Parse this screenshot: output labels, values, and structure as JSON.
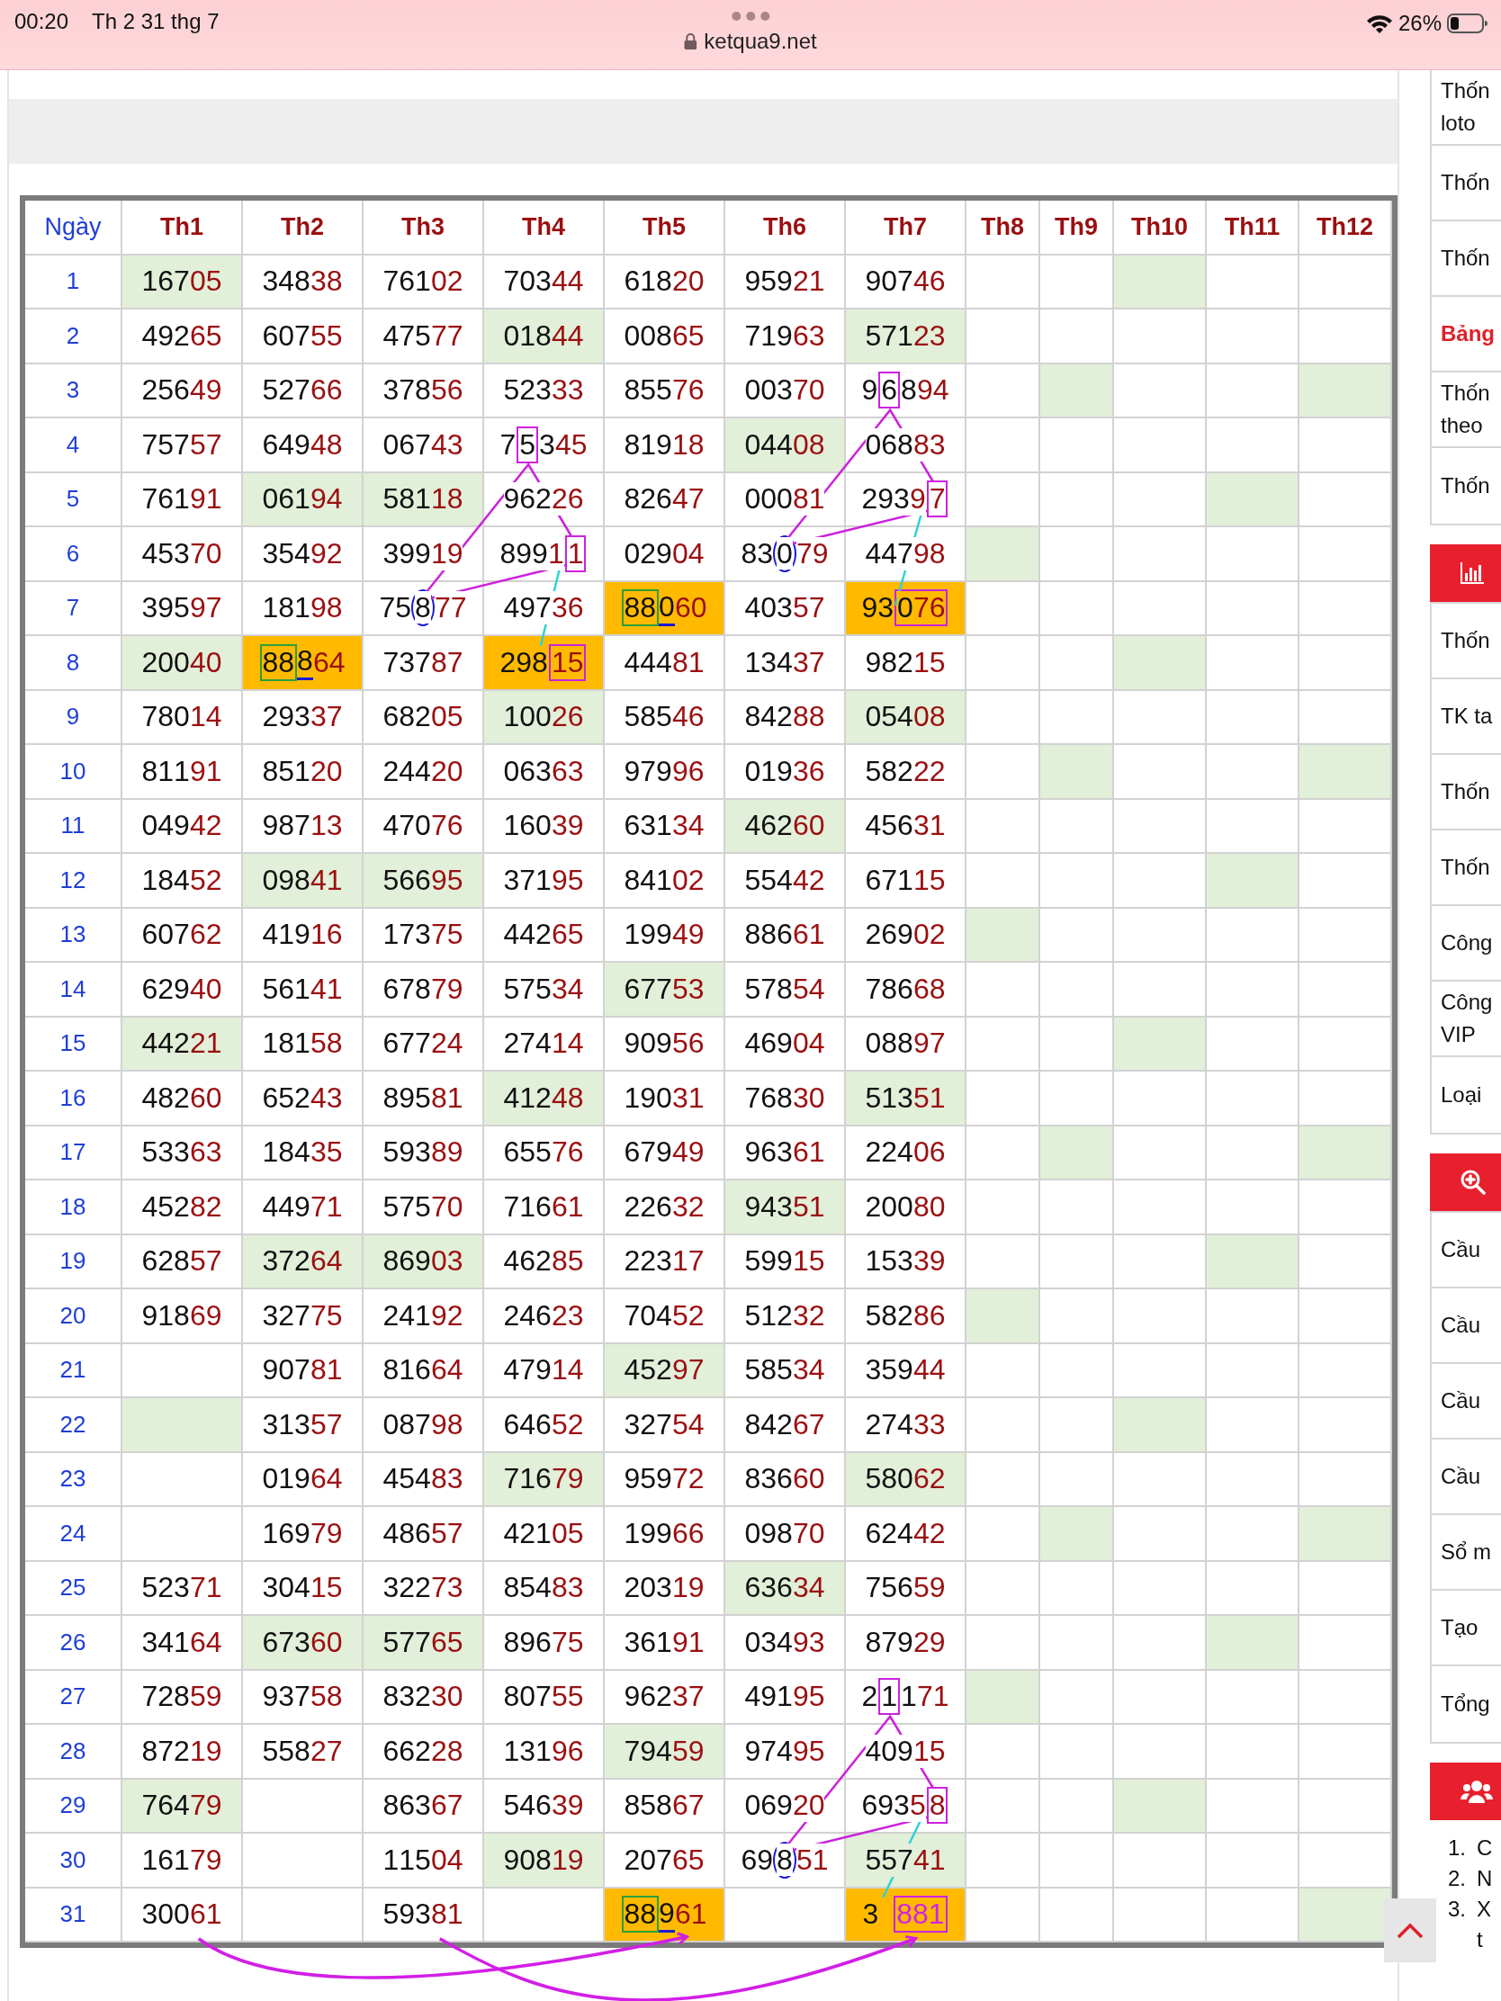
{
  "status_bar": {
    "time": "00:20",
    "date": "Th 2 31 thg 7",
    "url": "ketqua9.net",
    "battery": "26%"
  },
  "table": {
    "columns": [
      "Ngày",
      "Th1",
      "Th2",
      "Th3",
      "Th4",
      "Th5",
      "Th6",
      "Th7",
      "Th8",
      "Th9",
      "Th10",
      "Th11",
      "Th12"
    ],
    "rows": [
      {
        "cells": [
          {
            "value": "1"
          },
          {
            "value": "16705",
            "color": "#e2efd9"
          },
          {
            "value": "34838"
          },
          {
            "value": "76102"
          },
          {
            "value": "70344"
          },
          {
            "value": "61820"
          },
          {
            "value": "95921"
          },
          {
            "value": "90746"
          },
          {},
          {},
          {
            "color": "#e2efd9"
          },
          {},
          {}
        ]
      },
      {
        "cells": [
          {
            "value": "2"
          },
          {
            "value": "49265"
          },
          {
            "value": "60755"
          },
          {
            "value": "47577"
          },
          {
            "value": "01844",
            "color": "#e2efd9"
          },
          {
            "value": "00865"
          },
          {
            "value": "71963"
          },
          {
            "value": "57123",
            "color": "#e2efd9"
          },
          {},
          {},
          {},
          {},
          {}
        ]
      },
      {
        "cells": [
          {
            "value": "3"
          },
          {
            "value": "25649"
          },
          {
            "value": "52766"
          },
          {
            "value": "37856"
          },
          {
            "value": "52333"
          },
          {
            "value": "85576"
          },
          {
            "value": "00370"
          },
          {
            "parts": [
              {
                "text": "9"
              },
              {
                "text": "6",
                "kind": "box"
              },
              {
                "text": "894"
              }
            ]
          },
          {},
          {
            "color": "#e2efd9"
          },
          {},
          {},
          {
            "color": "#e2efd9"
          }
        ]
      },
      {
        "cells": [
          {
            "value": "4"
          },
          {
            "value": "75757"
          },
          {
            "value": "64948"
          },
          {
            "value": "06743"
          },
          {
            "parts": [
              {
                "text": "7"
              },
              {
                "text": "5",
                "kind": "box"
              },
              {
                "text": "345"
              }
            ]
          },
          {
            "value": "81918"
          },
          {
            "value": "04408",
            "color": "#e2efd9"
          },
          {
            "value": "06883"
          },
          {},
          {},
          {},
          {},
          {}
        ]
      },
      {
        "cells": [
          {
            "value": "5"
          },
          {
            "value": "76191"
          },
          {
            "value": "06194",
            "color": "#e2efd9"
          },
          {
            "value": "58118",
            "color": "#e2efd9"
          },
          {
            "value": "96226"
          },
          {
            "value": "82647"
          },
          {
            "value": "00081"
          },
          {
            "parts": [
              {
                "text": "2939"
              },
              {
                "text": "7",
                "kind": "box"
              }
            ]
          },
          {},
          {},
          {},
          {
            "color": "#e2efd9"
          },
          {}
        ]
      },
      {
        "cells": [
          {
            "value": "6"
          },
          {
            "value": "45370"
          },
          {
            "value": "35492"
          },
          {
            "value": "39919"
          },
          {
            "parts": [
              {
                "text": "8991"
              },
              {
                "text": "1",
                "kind": "box"
              }
            ]
          },
          {
            "value": "02904"
          },
          {
            "parts": [
              {
                "text": "83"
              },
              {
                "text": "0",
                "kind": "circle"
              },
              {
                "text": "79"
              }
            ]
          },
          {
            "value": "44798"
          },
          {
            "color": "#e2efd9"
          },
          {},
          {},
          {},
          {}
        ]
      },
      {
        "cells": [
          {
            "value": "7"
          },
          {
            "value": "39597"
          },
          {
            "value": "18198"
          },
          {
            "parts": [
              {
                "text": "75"
              },
              {
                "text": "8",
                "kind": "circle"
              },
              {
                "text": "77"
              }
            ]
          },
          {
            "value": "49736"
          },
          {
            "parts": [
              {
                "text": "88",
                "kind": "green-box"
              },
              {
                "text": "0",
                "kind": "underline"
              },
              {
                "text": "60"
              }
            ],
            "color": "#ffba00"
          },
          {
            "value": "40357"
          },
          {
            "parts": [
              {
                "text": "93"
              },
              {
                "text": "076",
                "kind": "box"
              }
            ],
            "color": "#ffba00"
          },
          {},
          {},
          {},
          {},
          {}
        ]
      },
      {
        "cells": [
          {
            "value": "8"
          },
          {
            "value": "20040",
            "color": "#e2efd9"
          },
          {
            "parts": [
              {
                "text": "88",
                "kind": "green-box"
              },
              {
                "text": "8",
                "kind": "underline"
              },
              {
                "text": "64"
              }
            ],
            "color": "#ffba00"
          },
          {
            "value": "73787"
          },
          {
            "parts": [
              {
                "text": "298"
              },
              {
                "text": "15",
                "kind": "box"
              }
            ],
            "color": "#ffba00"
          },
          {
            "value": "44481"
          },
          {
            "value": "13437"
          },
          {
            "value": "98215"
          },
          {},
          {},
          {
            "color": "#e2efd9"
          },
          {},
          {}
        ]
      },
      {
        "cells": [
          {
            "value": "9"
          },
          {
            "value": "78014"
          },
          {
            "value": "29337"
          },
          {
            "value": "68205"
          },
          {
            "value": "10026",
            "color": "#e2efd9"
          },
          {
            "value": "58546"
          },
          {
            "value": "84288"
          },
          {
            "value": "05408",
            "color": "#e2efd9"
          },
          {},
          {},
          {},
          {},
          {}
        ]
      },
      {
        "cells": [
          {
            "value": "10"
          },
          {
            "value": "81191"
          },
          {
            "value": "85120"
          },
          {
            "value": "24420"
          },
          {
            "value": "06363"
          },
          {
            "value": "97996"
          },
          {
            "value": "01936"
          },
          {
            "value": "58222"
          },
          {},
          {
            "color": "#e2efd9"
          },
          {},
          {},
          {
            "color": "#e2efd9"
          }
        ]
      },
      {
        "cells": [
          {
            "value": "11"
          },
          {
            "value": "04942"
          },
          {
            "value": "98713"
          },
          {
            "value": "47076"
          },
          {
            "value": "16039"
          },
          {
            "value": "63134"
          },
          {
            "value": "46260",
            "color": "#e2efd9"
          },
          {
            "value": "45631"
          },
          {},
          {},
          {},
          {},
          {}
        ]
      },
      {
        "cells": [
          {
            "value": "12"
          },
          {
            "value": "18452"
          },
          {
            "value": "09841",
            "color": "#e2efd9"
          },
          {
            "value": "56695",
            "color": "#e2efd9"
          },
          {
            "value": "37195"
          },
          {
            "value": "84102"
          },
          {
            "value": "55442"
          },
          {
            "value": "67115"
          },
          {},
          {},
          {},
          {
            "color": "#e2efd9"
          },
          {}
        ]
      },
      {
        "cells": [
          {
            "value": "13"
          },
          {
            "value": "60762"
          },
          {
            "value": "41916"
          },
          {
            "value": "17375"
          },
          {
            "value": "44265"
          },
          {
            "value": "19949"
          },
          {
            "value": "88661"
          },
          {
            "value": "26902"
          },
          {
            "color": "#e2efd9"
          },
          {},
          {},
          {},
          {}
        ]
      },
      {
        "cells": [
          {
            "value": "14"
          },
          {
            "value": "62940"
          },
          {
            "value": "56141"
          },
          {
            "value": "67879"
          },
          {
            "value": "57534"
          },
          {
            "value": "67753",
            "color": "#e2efd9"
          },
          {
            "value": "57854"
          },
          {
            "value": "78668"
          },
          {},
          {},
          {},
          {},
          {}
        ]
      },
      {
        "cells": [
          {
            "value": "15"
          },
          {
            "value": "44221",
            "color": "#e2efd9"
          },
          {
            "value": "18158"
          },
          {
            "value": "67724"
          },
          {
            "value": "27414"
          },
          {
            "value": "90956"
          },
          {
            "value": "46904"
          },
          {
            "value": "08897"
          },
          {},
          {},
          {
            "color": "#e2efd9"
          },
          {},
          {}
        ]
      },
      {
        "cells": [
          {
            "value": "16"
          },
          {
            "value": "48260"
          },
          {
            "value": "65243"
          },
          {
            "value": "89581"
          },
          {
            "value": "41248",
            "color": "#e2efd9"
          },
          {
            "value": "19031"
          },
          {
            "value": "76830"
          },
          {
            "value": "51351",
            "color": "#e2efd9"
          },
          {},
          {},
          {},
          {},
          {}
        ]
      },
      {
        "cells": [
          {
            "value": "17"
          },
          {
            "value": "53363"
          },
          {
            "value": "18435"
          },
          {
            "value": "59389"
          },
          {
            "value": "65576"
          },
          {
            "value": "67949"
          },
          {
            "value": "96361"
          },
          {
            "value": "22406"
          },
          {},
          {
            "color": "#e2efd9"
          },
          {},
          {},
          {
            "color": "#e2efd9"
          }
        ]
      },
      {
        "cells": [
          {
            "value": "18"
          },
          {
            "value": "45282"
          },
          {
            "value": "44971"
          },
          {
            "value": "57570"
          },
          {
            "value": "71661"
          },
          {
            "value": "22632"
          },
          {
            "value": "94351",
            "color": "#e2efd9"
          },
          {
            "value": "20080"
          },
          {},
          {},
          {},
          {},
          {}
        ]
      },
      {
        "cells": [
          {
            "value": "19"
          },
          {
            "value": "62857"
          },
          {
            "value": "37264",
            "color": "#e2efd9"
          },
          {
            "value": "86903",
            "color": "#e2efd9"
          },
          {
            "value": "46285"
          },
          {
            "value": "22317"
          },
          {
            "value": "59915"
          },
          {
            "value": "15339"
          },
          {},
          {},
          {},
          {
            "color": "#e2efd9"
          },
          {}
        ]
      },
      {
        "cells": [
          {
            "value": "20"
          },
          {
            "value": "91869"
          },
          {
            "value": "32775"
          },
          {
            "value": "24192"
          },
          {
            "value": "24623"
          },
          {
            "value": "70452"
          },
          {
            "value": "51232"
          },
          {
            "value": "58286"
          },
          {
            "color": "#e2efd9"
          },
          {},
          {},
          {},
          {}
        ]
      },
      {
        "cells": [
          {
            "value": "21"
          },
          {},
          {
            "value": "90781"
          },
          {
            "value": "81664"
          },
          {
            "value": "47914"
          },
          {
            "value": "45297",
            "color": "#e2efd9"
          },
          {
            "value": "58534"
          },
          {
            "value": "35944"
          },
          {},
          {},
          {},
          {},
          {}
        ]
      },
      {
        "cells": [
          {
            "value": "22"
          },
          {
            "color": "#e2efd9"
          },
          {
            "value": "31357"
          },
          {
            "value": "08798"
          },
          {
            "value": "64652"
          },
          {
            "value": "32754"
          },
          {
            "value": "84267"
          },
          {
            "value": "27433"
          },
          {},
          {},
          {
            "color": "#e2efd9"
          },
          {},
          {}
        ]
      },
      {
        "cells": [
          {
            "value": "23"
          },
          {},
          {
            "value": "01964"
          },
          {
            "value": "45483"
          },
          {
            "value": "71679",
            "color": "#e2efd9"
          },
          {
            "value": "95972"
          },
          {
            "value": "83660"
          },
          {
            "value": "58062",
            "color": "#e2efd9"
          },
          {},
          {},
          {},
          {},
          {}
        ]
      },
      {
        "cells": [
          {
            "value": "24"
          },
          {},
          {
            "value": "16979"
          },
          {
            "value": "48657"
          },
          {
            "value": "42105"
          },
          {
            "value": "19966"
          },
          {
            "value": "09870"
          },
          {
            "value": "62442"
          },
          {},
          {
            "color": "#e2efd9"
          },
          {},
          {},
          {
            "color": "#e2efd9"
          }
        ]
      },
      {
        "cells": [
          {
            "value": "25"
          },
          {
            "value": "52371"
          },
          {
            "value": "30415"
          },
          {
            "value": "32273"
          },
          {
            "value": "85483"
          },
          {
            "value": "20319"
          },
          {
            "value": "63634",
            "color": "#e2efd9"
          },
          {
            "value": "75659"
          },
          {},
          {},
          {},
          {},
          {}
        ]
      },
      {
        "cells": [
          {
            "value": "26"
          },
          {
            "value": "34164"
          },
          {
            "value": "67360",
            "color": "#e2efd9"
          },
          {
            "value": "57765",
            "color": "#e2efd9"
          },
          {
            "value": "89675"
          },
          {
            "value": "36191"
          },
          {
            "value": "03493"
          },
          {
            "value": "87929"
          },
          {},
          {},
          {},
          {
            "color": "#e2efd9"
          },
          {}
        ]
      },
      {
        "cells": [
          {
            "value": "27"
          },
          {
            "value": "72859"
          },
          {
            "value": "93758"
          },
          {
            "value": "83230"
          },
          {
            "value": "80755"
          },
          {
            "value": "96237"
          },
          {
            "value": "49195"
          },
          {
            "parts": [
              {
                "text": "2"
              },
              {
                "text": "1",
                "kind": "box"
              },
              {
                "text": "171"
              }
            ]
          },
          {
            "color": "#e2efd9"
          },
          {},
          {},
          {},
          {}
        ]
      },
      {
        "cells": [
          {
            "value": "28"
          },
          {
            "value": "87219"
          },
          {
            "value": "55827"
          },
          {
            "value": "66228"
          },
          {
            "value": "13196"
          },
          {
            "value": "79459",
            "color": "#e2efd9"
          },
          {
            "value": "97495"
          },
          {
            "value": "40915"
          },
          {},
          {},
          {},
          {},
          {}
        ]
      },
      {
        "cells": [
          {
            "value": "29"
          },
          {
            "value": "76479",
            "color": "#e2efd9"
          },
          {},
          {
            "value": "86367"
          },
          {
            "value": "54639"
          },
          {
            "value": "85867"
          },
          {
            "value": "06920"
          },
          {
            "parts": [
              {
                "text": "6935"
              },
              {
                "text": "8",
                "kind": "box"
              }
            ]
          },
          {},
          {},
          {
            "color": "#e2efd9"
          },
          {},
          {}
        ]
      },
      {
        "cells": [
          {
            "value": "30"
          },
          {
            "value": "16179"
          },
          {},
          {
            "value": "11504"
          },
          {
            "value": "90819",
            "color": "#e2efd9"
          },
          {
            "value": "20765"
          },
          {
            "parts": [
              {
                "text": "69"
              },
              {
                "text": "8",
                "kind": "circle"
              },
              {
                "text": "51"
              }
            ]
          },
          {
            "value": "55741",
            "color": "#e2efd9"
          },
          {},
          {},
          {},
          {},
          {}
        ]
      },
      {
        "cells": [
          {
            "value": "31"
          },
          {
            "value": "30061"
          },
          {},
          {
            "value": "59381"
          },
          {},
          {
            "parts": [
              {
                "text": "88",
                "kind": "green-box"
              },
              {
                "text": "9",
                "kind": "underline"
              },
              {
                "text": "61"
              }
            ],
            "color": "#ffba00"
          },
          {},
          {
            "parts": [
              {
                "text": "3 "
              },
              {
                "text": "881",
                "kind": "box-tinted"
              }
            ],
            "color": "#ffba00"
          },
          {},
          {},
          {},
          {},
          {
            "color": "#e2efd9"
          }
        ]
      }
    ]
  },
  "sidebar": {
    "sections": [
      {
        "header": false,
        "items": [
          {
            "lines": [
              "Thốn",
              "loto"
            ],
            "emphasis": false
          },
          {
            "lines": [
              "Thốn"
            ],
            "emphasis": false
          },
          {
            "lines": [
              "Thốn"
            ],
            "emphasis": false
          },
          {
            "lines": [
              "Bảng"
            ],
            "emphasis": true
          },
          {
            "lines": [
              "Thốn",
              "theo"
            ],
            "emphasis": false
          },
          {
            "lines": [
              "Thốn"
            ],
            "emphasis": false
          }
        ]
      },
      {
        "header": true,
        "items": [
          {
            "lines": [
              "Thốn"
            ],
            "emphasis": false
          },
          {
            "lines": [
              "TK ta"
            ],
            "emphasis": false
          },
          {
            "lines": [
              "Thốn"
            ],
            "emphasis": false
          },
          {
            "lines": [
              "Thốn"
            ],
            "emphasis": false
          },
          {
            "lines": [
              "Công"
            ],
            "emphasis": false
          },
          {
            "lines": [
              "Công",
              "VIP"
            ],
            "emphasis": false
          },
          {
            "lines": [
              "Loại"
            ],
            "emphasis": false
          }
        ]
      },
      {
        "header": true,
        "items": [
          {
            "lines": [
              "Cầu"
            ],
            "emphasis": false
          },
          {
            "lines": [
              "Cầu"
            ],
            "emphasis": false
          },
          {
            "lines": [
              "Cầu"
            ],
            "emphasis": false
          },
          {
            "lines": [
              "Cầu"
            ],
            "emphasis": false
          },
          {
            "lines": [
              "Sổ m"
            ],
            "emphasis": false
          },
          {
            "lines": [
              "Tạo"
            ],
            "emphasis": false
          },
          {
            "lines": [
              "Tổng"
            ],
            "emphasis": false
          }
        ]
      },
      {
        "header": true,
        "list": [
          {
            "number": "1.",
            "lines": [
              "C"
            ]
          },
          {
            "number": "2.",
            "lines": [
              "N"
            ]
          },
          {
            "number": "3.",
            "lines": [
              "X",
              "t"
            ]
          }
        ]
      }
    ]
  }
}
